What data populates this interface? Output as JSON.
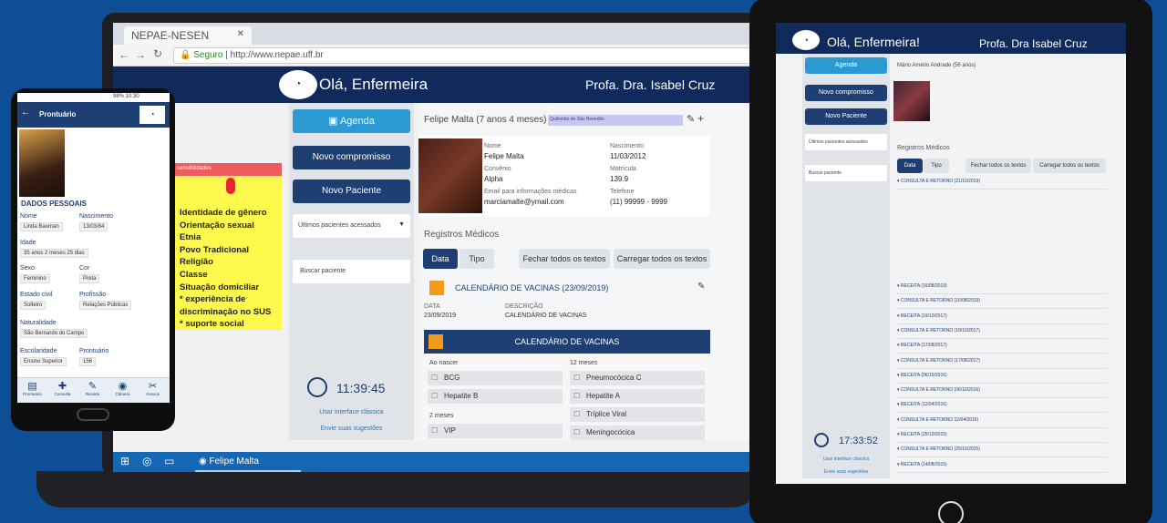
{
  "browser": {
    "tab_title": "NEPAE-NESEN",
    "tab_close": "✕",
    "url_secure": "Seguro",
    "url": "http://www.nepae.uff.br"
  },
  "header": {
    "greeting": "Olá, Enfermeira",
    "professor": "Profa. Dra. Isabel Cruz"
  },
  "sidebar": {
    "agenda": "Agenda",
    "new_appointment": "Novo compromisso",
    "new_patient": "Novo Paciente",
    "recent_patients": "Últimos pacientes acessados",
    "search_patient": "Buscar paciente",
    "clock": "11:39:45",
    "classic_ui": "Usar interface clássica",
    "send_suggestions": "Envie suas sugestões"
  },
  "sticky": {
    "header": "sensibilidades",
    "lines": [
      "Identidade de gênero",
      "Orientação sexual",
      "Etnia",
      "Povo Tradicional",
      "Religião",
      "Classe",
      "Situação domiciliar",
      "* experiência de",
      "discriminação no SUS",
      "* suporte social"
    ]
  },
  "patient": {
    "title": "Felipe Malta (7 anos 4 meses)",
    "tag": "Quilombo de São Benedito",
    "name_label": "Nome",
    "name": "Felipe Malta",
    "birth_label": "Nascimento",
    "birth": "11/03/2012",
    "agreement_label": "Convênio",
    "agreement": "Alpha",
    "reg_label": "Matrícula",
    "reg": "139.9",
    "email_label": "Email para informações médicas",
    "email": "marciamalte@ymail.com",
    "phone_label": "Telefone",
    "phone": "(11) 99999 - 9999"
  },
  "records": {
    "title": "Registros Médicos",
    "tab_date": "Data",
    "tab_type": "Tipo",
    "close_all": "Fechar todos os textos",
    "load_all": "Carregar todos os textos",
    "entry_title": "CALENDÁRIO DE VACINAS (23/09/2019)",
    "date_label": "DATA",
    "date": "23/09/2019",
    "desc_label": "DESCRIÇÃO",
    "desc": "CALENDÁRIO DE VACINAS",
    "banner": "CALENDÁRIO DE VACINAS",
    "col1_header": "Ao nascer",
    "col2_header": "12 meses",
    "col1": [
      "BCG",
      "Hepatite B"
    ],
    "col2": [
      "Pneumocócica C",
      "Hepatite A",
      "Tríplice Viral",
      "Meningocócica"
    ],
    "col1_b_header": "2 meses",
    "col1_b": [
      "VIP"
    ]
  },
  "taskbar": {
    "app": "Felipe Malta"
  },
  "phone": {
    "status": "98% 10:30",
    "title": "Prontuário",
    "section": "DADOS PESSOAIS",
    "fields": [
      {
        "label": "Nome",
        "value": "Linda Bauman"
      },
      {
        "label": "Nascimento",
        "value": "13/03/84"
      },
      {
        "label": "Idade",
        "value": "35 anos 2 meses 25 dias"
      },
      {
        "label": "Sexo",
        "value": "Feminino"
      },
      {
        "label": "Cor",
        "value": "Preta"
      },
      {
        "label": "Estado civil",
        "value": "Solteiro"
      },
      {
        "label": "Profissão",
        "value": "Relações Públicas"
      },
      {
        "label": "Naturalidade",
        "value": "São Bernardo do Campo"
      },
      {
        "label": "Escolaridade",
        "value": "Ensino Superior"
      },
      {
        "label": "Prontuário",
        "value": "156"
      }
    ],
    "nav": [
      "Prontuário",
      "Consulta",
      "Receita",
      "Câmera",
      "Anexos"
    ]
  },
  "tablet": {
    "greeting": "Olá, Enfermeira!",
    "professor": "Profa. Dra Isabel Cruz",
    "agenda": "Agenda",
    "new_appointment": "Novo compromisso",
    "new_patient": "Novo Paciente",
    "recent": "Últimos pacientes acessados",
    "search": "Buscar paciente",
    "patient_title": "Mário Amério Andrade (56 anos)",
    "records": "Registros Médicos",
    "tab_date": "Data",
    "tab_type": "Tipo",
    "close_all": "Fechar todos os textos",
    "load_all": "Carregar todos os textos",
    "clock": "17:33:52",
    "classic": "Usar interface clássica",
    "suggest": "Envie suas sugestões",
    "rows": [
      "CONSULTA E RETORNO (21/10/2019)",
      "RECEITA (16/08/2019)",
      "CONSULTA E RETORNO (16/08/2019)",
      "RECEITA (19/10/2017)",
      "CONSULTA E RETORNO (19/10/2017)",
      "RECEITA (17/08/2017)",
      "CONSULTA E RETORNO (17/08/2017)",
      "RECEITA (06/10/2016)",
      "CONSULTA E RETORNO (06/10/2016)",
      "RECEITA (12/04/2016)",
      "CONSULTA E RETORNO 12/04/2016)",
      "RECEITA (25/10/2015)",
      "CONSULTA E RETORNO (25/10/2015)",
      "RECEITA (14/08/2015)"
    ]
  }
}
